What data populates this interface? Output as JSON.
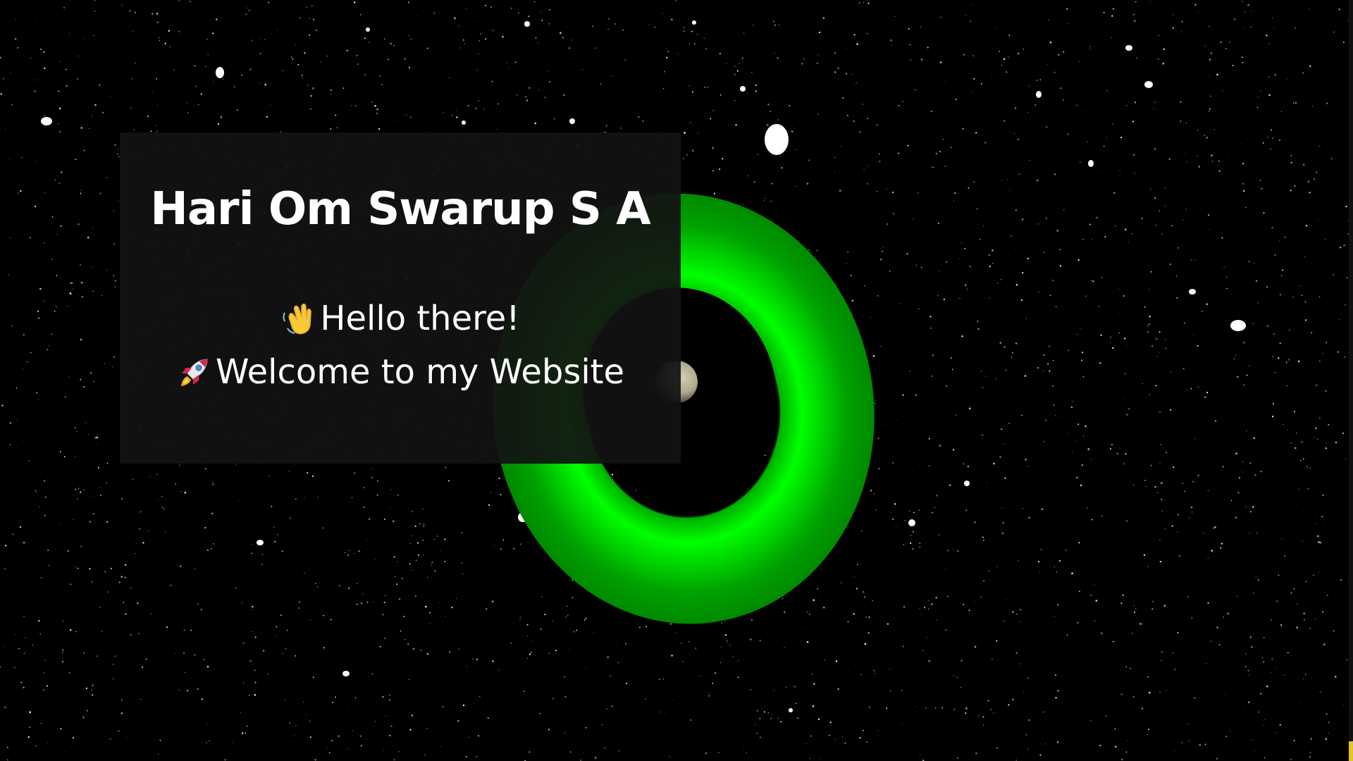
{
  "hero": {
    "name": "Hari Om Swarup S A",
    "greeting": "Hello there!",
    "welcome": "Welcome to my Website",
    "greeting_icon": "waving-hand-icon",
    "welcome_icon": "rocket-icon"
  },
  "colors": {
    "background": "#000000",
    "card": "#121212",
    "torus": "#00ff00",
    "text": "#ffffff",
    "scroll_accent": "#e6c51f"
  }
}
